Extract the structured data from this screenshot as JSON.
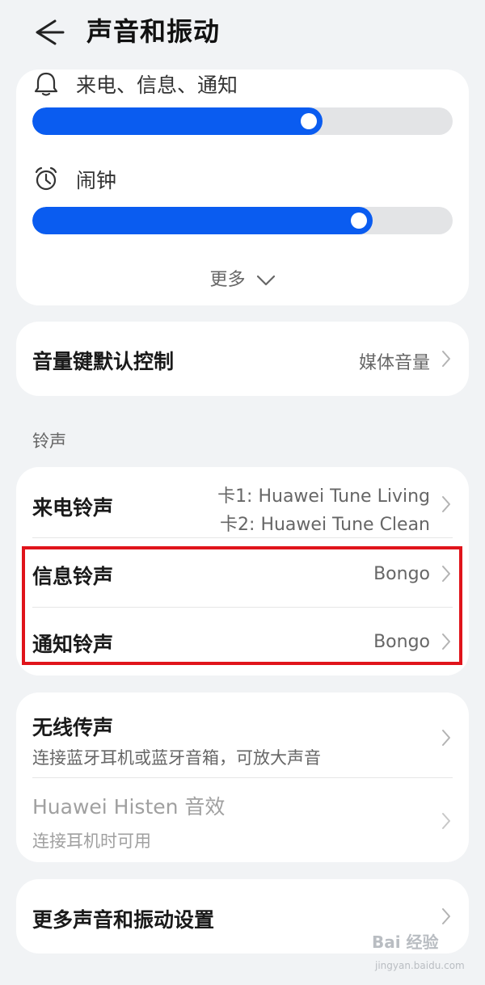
{
  "header": {
    "title": "声音和振动"
  },
  "volume": {
    "ringtone_label": "来电、信息、通知",
    "ringtone_level": 0.69,
    "alarm_label": "闹钟",
    "alarm_level": 0.81,
    "more_label": "更多"
  },
  "volume_key": {
    "label": "音量键默认控制",
    "value": "媒体音量"
  },
  "ringtones": {
    "section_label": "铃声",
    "incoming": {
      "label": "来电铃声",
      "value_line1": "卡1: Huawei Tune Living",
      "value_line2": "卡2: Huawei Tune Clean"
    },
    "message": {
      "label": "信息铃声",
      "value": "Bongo"
    },
    "notification": {
      "label": "通知铃声",
      "value": "Bongo"
    }
  },
  "wireless": {
    "label": "无线传声",
    "desc": "连接蓝牙耳机或蓝牙音箱，可放大声音",
    "histen_label": "Huawei Histen 音效",
    "histen_desc": "连接耳机时可用"
  },
  "more_settings": {
    "label": "更多声音和振动设置"
  },
  "watermark": {
    "text": "Bai 经验",
    "sub": "jingyan.baidu.com"
  },
  "colors": {
    "accent": "#0a5cf0",
    "highlight": "#e0141b",
    "background": "#f1f3f5"
  }
}
